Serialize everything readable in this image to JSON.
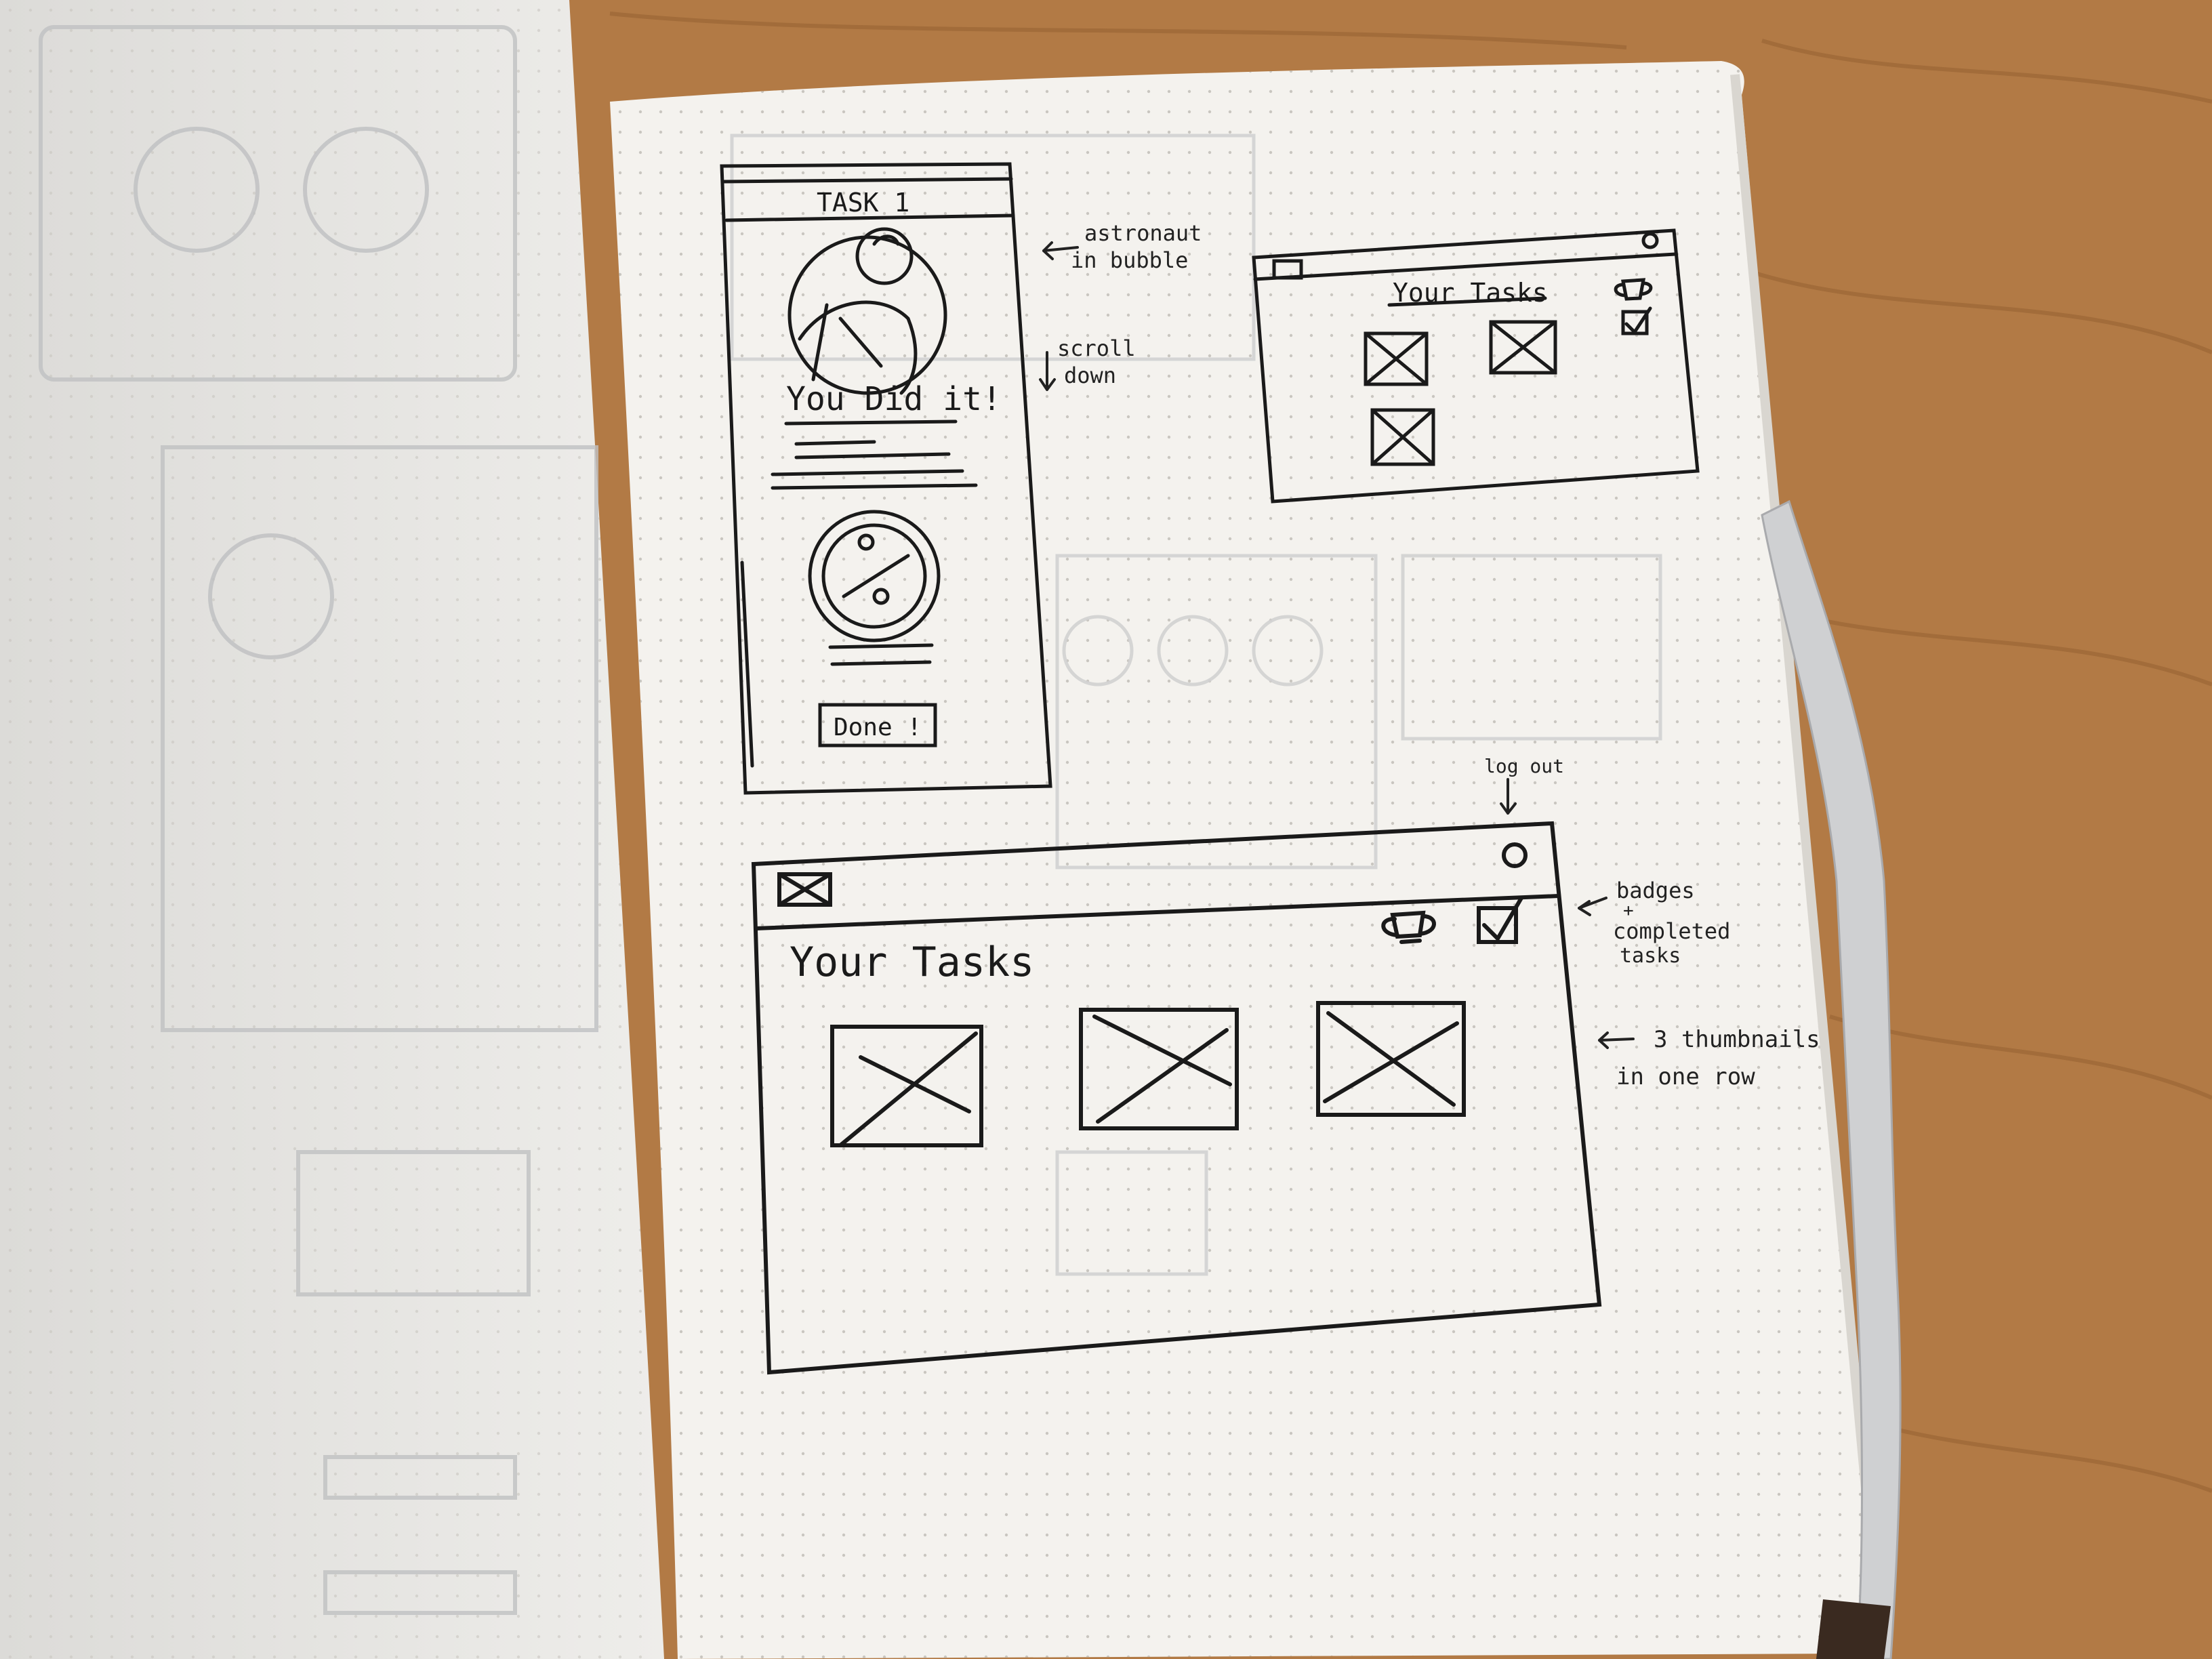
{
  "colors": {
    "table": "#b27a45",
    "table_dark": "#8e5a2c",
    "paper": "#f4f2ee",
    "paper_left": "#ebeae7",
    "ink": "#1a1a1a",
    "dot": "#c9c6c0",
    "band": "#cfd0d2"
  },
  "phone_sketch": {
    "title": "TASK 1",
    "message": "You Did it!",
    "done_button": "Done !",
    "icons": [
      "astronaut-bubble-icon",
      "badge-medal-icon"
    ]
  },
  "small_desktop_sketch": {
    "title": "Your Tasks",
    "icons": [
      "image-placeholder-icon",
      "logout-circle-icon",
      "trophy-icon",
      "checkbox-icon"
    ],
    "thumbnail_count": 3
  },
  "large_desktop_sketch": {
    "title": "Your Tasks",
    "icons": [
      "image-placeholder-icon",
      "logout-circle-icon",
      "trophy-icon",
      "checkbox-icon"
    ],
    "thumbnail_count": 3
  },
  "annotations": {
    "astronaut_1": "astronaut",
    "astronaut_2": "in bubble",
    "scroll_1": "scroll",
    "scroll_2": "down",
    "logout": "log out",
    "badges_1": "badges",
    "badges_2": "+",
    "badges_3": "completed",
    "badges_4": "tasks",
    "thumbs_1": "3 thumbnails",
    "thumbs_2": "in one row"
  }
}
